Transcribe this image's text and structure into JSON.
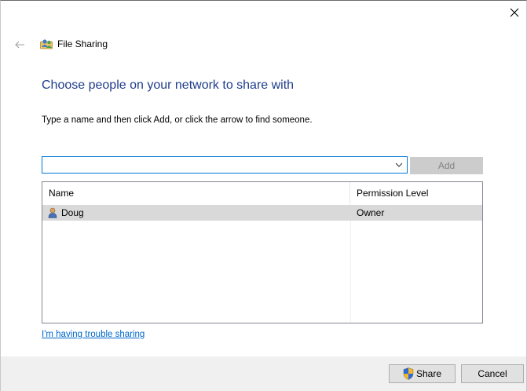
{
  "window": {
    "title": "File Sharing",
    "icons": {
      "close": "close-icon",
      "back": "back-arrow-icon",
      "app": "file-sharing-icon"
    }
  },
  "main": {
    "heading": "Choose people on your network to share with",
    "instruction": "Type a name and then click Add, or click the arrow to find someone.",
    "name_input": {
      "value": "",
      "placeholder": ""
    },
    "add_label": "Add",
    "list": {
      "columns": [
        "Name",
        "Permission Level"
      ],
      "rows": [
        {
          "name": "Doug",
          "permission": "Owner",
          "icon": "user-icon"
        }
      ]
    },
    "trouble_link": "I'm having trouble sharing"
  },
  "footer": {
    "share_label": "Share",
    "cancel_label": "Cancel"
  },
  "colors": {
    "heading": "#1f3d8c",
    "link": "#0066cc",
    "focus_border": "#0078d7",
    "selected_row": "#d9d9d9",
    "footer_bg": "#f0f0f0"
  }
}
